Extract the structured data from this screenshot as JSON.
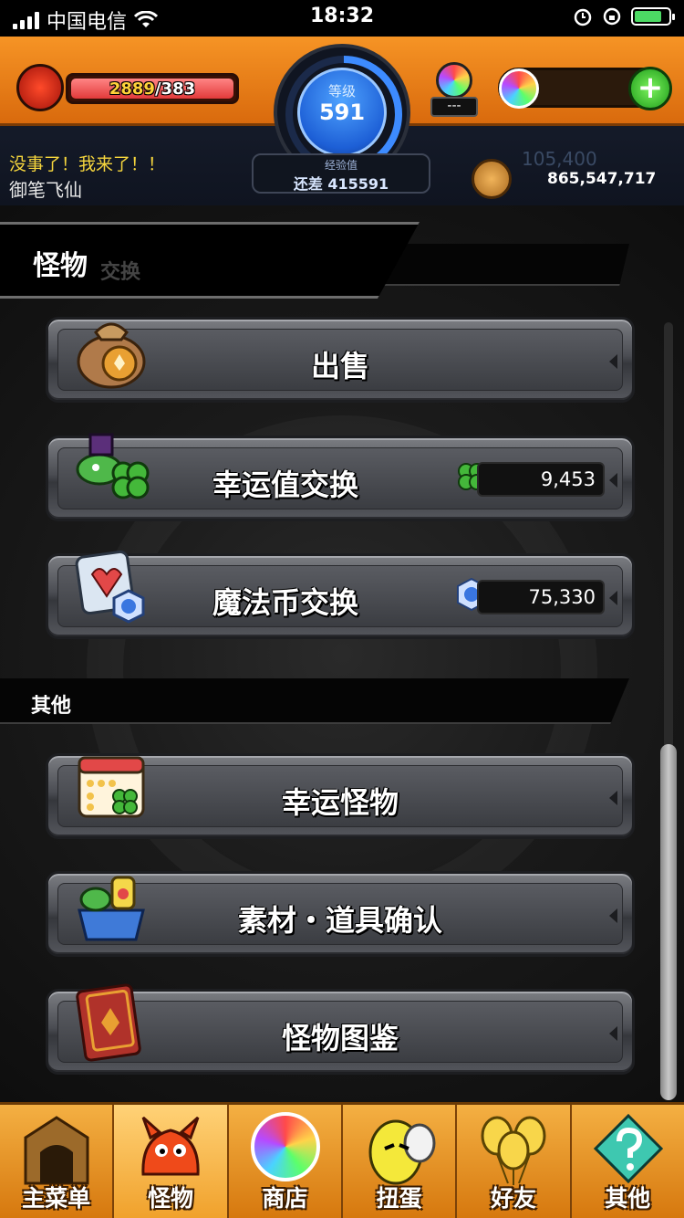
{
  "status_bar": {
    "carrier": "中国电信",
    "time": "18:32",
    "battery_level": 0.8
  },
  "header": {
    "stamina": {
      "current": "2889",
      "separator_max": "/383",
      "fill": 1.0
    },
    "level": {
      "label": "等级",
      "value": "591",
      "progress": 0.45
    },
    "exp": {
      "label": "经验值",
      "remaining": "还差 415591"
    },
    "gem_counter": "---",
    "message": "没事了！我来了！！",
    "player_name": "御笔飞仙",
    "gold": "865,547,717",
    "ghost_number": "105,400"
  },
  "monster_section": {
    "title": "怪物",
    "subtitle": "交换",
    "buttons": [
      {
        "label": "出售",
        "icon": "money-bag-icon"
      },
      {
        "label": "幸运值交换",
        "icon": "clover-turtle-icon",
        "value": "9,453",
        "value_icon": "clover-icon"
      },
      {
        "label": "魔法币交换",
        "icon": "magic-card-icon",
        "value": "75,330",
        "value_icon": "magic-coin-icon"
      }
    ]
  },
  "other_section": {
    "title": "其他",
    "buttons": [
      {
        "label": "幸运怪物",
        "icon": "calendar-clover-icon"
      },
      {
        "label": "素材・道具确认",
        "icon": "item-basket-icon"
      },
      {
        "label": "怪物图鉴",
        "icon": "monster-book-icon"
      }
    ]
  },
  "bottom_nav": [
    {
      "label": "主菜单",
      "icon": "gate-icon"
    },
    {
      "label": "怪物",
      "icon": "dragon-monster-icon",
      "active": true
    },
    {
      "label": "商店",
      "icon": "rainbow-orb-icon"
    },
    {
      "label": "扭蛋",
      "icon": "egg-icon"
    },
    {
      "label": "好友",
      "icon": "balloons-icon"
    },
    {
      "label": "其他",
      "icon": "question-icon"
    }
  ],
  "colors": {
    "header_orange": "#f69425",
    "nav_orange": "#f4b043",
    "message_yellow": "#f5d53d",
    "stamina_red": "#e23a3a",
    "level_blue": "#1d5fd6",
    "plus_green": "#1e9c1a"
  }
}
